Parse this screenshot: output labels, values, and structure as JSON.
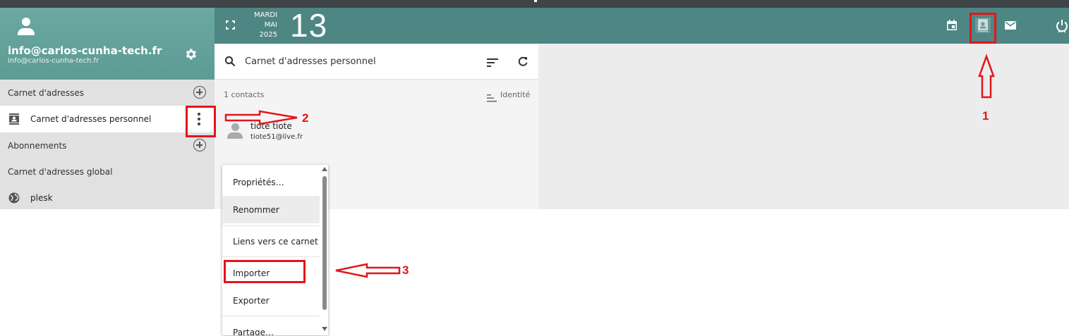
{
  "sidebar": {
    "account_email": "info@carlos-cunha-tech.fr",
    "account_email_small": "info@carlos-cunha-tech.fr",
    "sections": {
      "address_books": "Carnet d'adresses",
      "subscriptions": "Abonnements",
      "global": "Carnet d'adresses global"
    },
    "items": {
      "personal": "Carnet d'adresses personnel",
      "plesk": "plesk"
    }
  },
  "topbar": {
    "day": "MARDI",
    "month": "MAI",
    "year": "2025",
    "date": "13"
  },
  "contacts": {
    "list_title": "Carnet d'adresses personnel",
    "count": "1 contacts",
    "sort_label": "Identité",
    "rows": [
      {
        "name": "tiote tiote",
        "email": "tiote51@live.fr"
      }
    ]
  },
  "menu": {
    "items": [
      "Propriétés…",
      "Renommer",
      "Liens vers ce carnet",
      "Importer",
      "Exporter",
      "Partage…"
    ]
  },
  "annotations": {
    "labels": [
      "1",
      "2",
      "3"
    ],
    "color": "#e2151a"
  },
  "colors": {
    "header_teal": "#4d8683",
    "sidebar_header": "#6aa8a1",
    "annotation_red": "#e2151a"
  }
}
